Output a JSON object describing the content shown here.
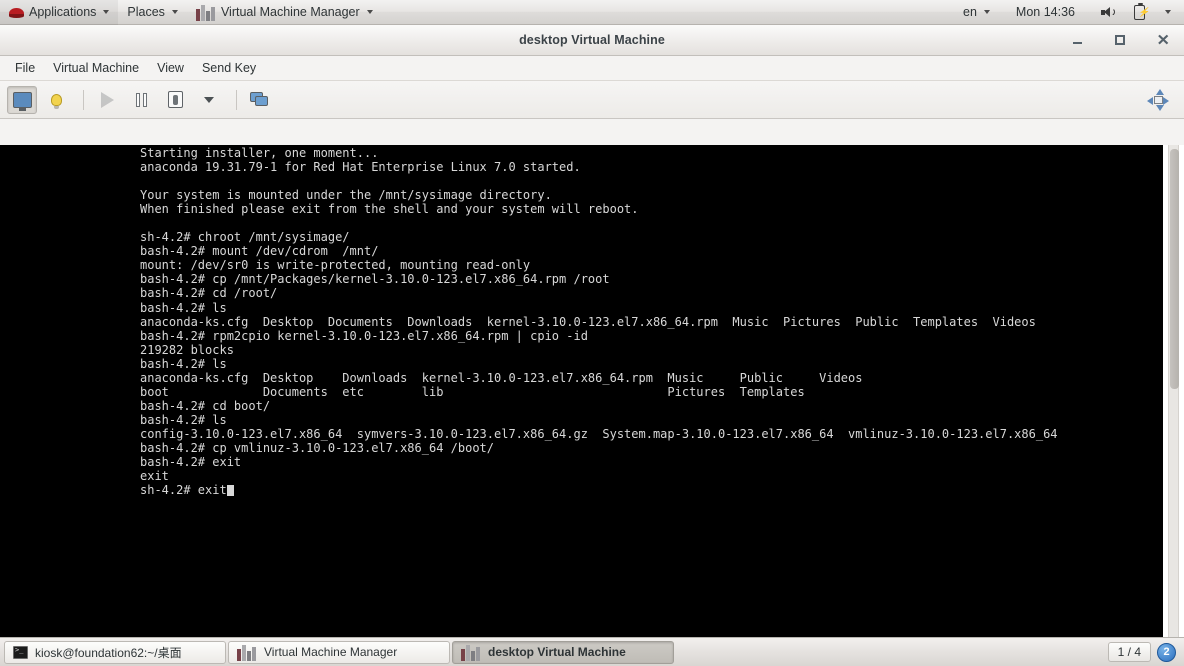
{
  "top_panel": {
    "applications_label": "Applications",
    "places_label": "Places",
    "app_title": "Virtual Machine Manager",
    "keyboard_layout": "en",
    "clock": "Mon 14:36",
    "icons": {
      "redhat": "redhat-logo-icon",
      "app": "virtual-machine-manager-icon",
      "volume": "volume-icon",
      "battery": "battery-icon",
      "system_menu": "chevron-down-icon"
    }
  },
  "window": {
    "title": "desktop Virtual Machine",
    "buttons": {
      "minimize": "–",
      "maximize": "❐",
      "close": "✕"
    },
    "menu": [
      "File",
      "Virtual Machine",
      "View",
      "Send Key"
    ],
    "toolbar": [
      {
        "name": "show-console-button",
        "icon": "monitor-icon",
        "state": "active"
      },
      {
        "name": "show-details-button",
        "icon": "lightbulb-icon",
        "state": "normal"
      },
      {
        "name": "run-button",
        "icon": "play-icon",
        "state": "disabled"
      },
      {
        "name": "pause-button",
        "icon": "pause-icon",
        "state": "normal"
      },
      {
        "name": "shutdown-button",
        "icon": "power-icon",
        "state": "normal"
      },
      {
        "name": "shutdown-menu-button",
        "icon": "chevron-down-icon",
        "state": "normal"
      },
      {
        "name": "snapshots-button",
        "icon": "screens-icon",
        "state": "normal"
      },
      {
        "name": "fullscreen-button",
        "icon": "resize-icon",
        "state": "normal"
      }
    ]
  },
  "console": {
    "lines": [
      "Starting installer, one moment...",
      "anaconda 19.31.79-1 for Red Hat Enterprise Linux 7.0 started.",
      "",
      "Your system is mounted under the /mnt/sysimage directory.",
      "When finished please exit from the shell and your system will reboot.",
      "",
      "sh-4.2# chroot /mnt/sysimage/",
      "bash-4.2# mount /dev/cdrom  /mnt/",
      "mount: /dev/sr0 is write-protected, mounting read-only",
      "bash-4.2# cp /mnt/Packages/kernel-3.10.0-123.el7.x86_64.rpm /root",
      "bash-4.2# cd /root/",
      "bash-4.2# ls",
      "anaconda-ks.cfg  Desktop  Documents  Downloads  kernel-3.10.0-123.el7.x86_64.rpm  Music  Pictures  Public  Templates  Videos",
      "bash-4.2# rpm2cpio kernel-3.10.0-123.el7.x86_64.rpm | cpio -id",
      "219282 blocks",
      "bash-4.2# ls",
      "anaconda-ks.cfg  Desktop    Downloads  kernel-3.10.0-123.el7.x86_64.rpm  Music     Public     Videos",
      "boot             Documents  etc        lib                               Pictures  Templates",
      "bash-4.2# cd boot/",
      "bash-4.2# ls",
      "config-3.10.0-123.el7.x86_64  symvers-3.10.0-123.el7.x86_64.gz  System.map-3.10.0-123.el7.x86_64  vmlinuz-3.10.0-123.el7.x86_64",
      "bash-4.2# cp vmlinuz-3.10.0-123.el7.x86_64 /boot/",
      "bash-4.2# exit",
      "exit"
    ],
    "prompt_line": "sh-4.2# exit",
    "colors": {
      "background": "#000000",
      "foreground": "#d8d8d8"
    }
  },
  "taskbar": {
    "tasks": [
      {
        "label": "kiosk@foundation62:~/桌面",
        "icon": "terminal-icon",
        "active": false
      },
      {
        "label": "Virtual Machine Manager",
        "icon": "virtual-machine-manager-icon",
        "active": false
      },
      {
        "label": "desktop Virtual Machine",
        "icon": "virtual-machine-manager-icon",
        "active": true
      }
    ],
    "workspace_indicator": "1 / 4",
    "notification_count": "2"
  }
}
